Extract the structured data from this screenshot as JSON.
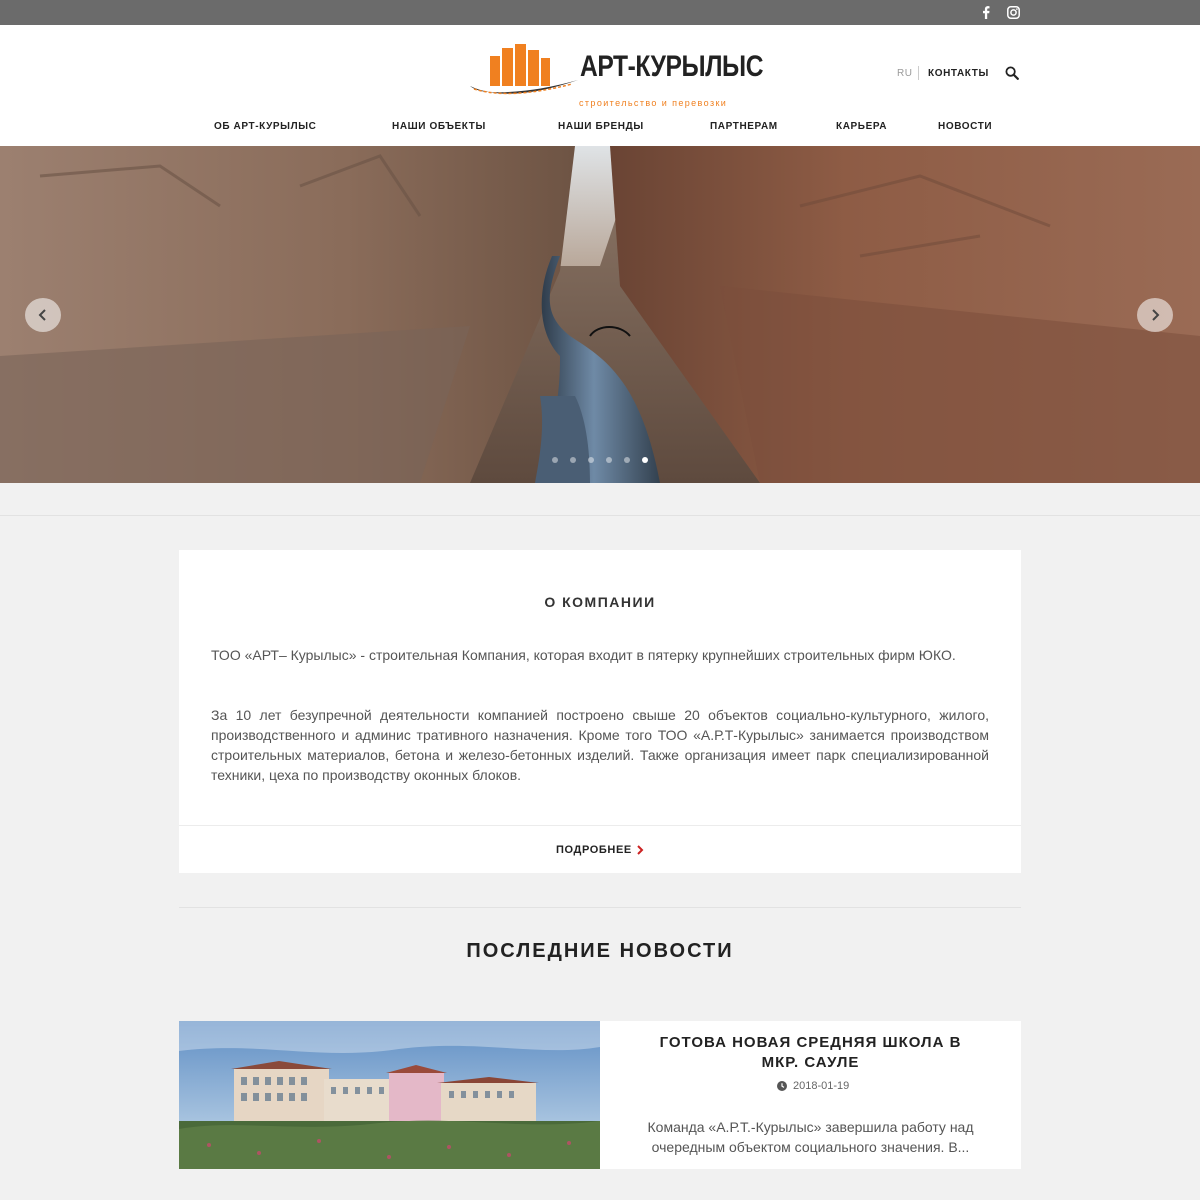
{
  "topbar": {
    "social": [
      {
        "name": "facebook-icon"
      },
      {
        "name": "instagram-icon"
      }
    ]
  },
  "header": {
    "logo": {
      "title": "АРТ-КУРЫЛЫС",
      "subtitle": "строительство и перевозки",
      "colors": {
        "orange": "#f08020",
        "dark": "#222222"
      }
    },
    "lang": "RU",
    "contacts": "КОНТАКТЫ",
    "nav": [
      "ОБ АРТ-КУРЫЛЫС",
      "НАШИ ОБЪЕКТЫ",
      "НАШИ БРЕНДЫ",
      "ПАРТНЕРАМ",
      "КАРЬЕРА",
      "НОВОСТИ"
    ]
  },
  "slider": {
    "slide_count": 6,
    "active_index": 5,
    "prev_icon": "chevron-left-icon",
    "next_icon": "chevron-right-icon"
  },
  "about": {
    "title": "О КОМПАНИИ",
    "paragraph1": "ТОО «АРТ– Курылыс» - строительная Компания, которая входит в пятерку крупнейших строительных фирм ЮКО.",
    "paragraph2": "За 10 лет безупречной деятельности компанией построено свыше 20 объектов социально-культурного, жилого, производственного и админис тративного назначения. Кроме того ТОО «А.Р.Т-Курылыс» занимается производством строительных материалов, бетона и железо-бетонных изделий. Также организация имеет парк специализированной техники, цеха по производству оконных блоков.",
    "more_label": "ПОДРОБНЕЕ",
    "accent_color": "#cc2222"
  },
  "news": {
    "heading": "ПОСЛЕДНИЕ НОВОСТИ",
    "items": [
      {
        "title": "ГОТОВА НОВАЯ СРЕДНЯЯ ШКОЛА В МКР. САУЛЕ",
        "date": "2018-01-19",
        "excerpt": "Команда «А.Р.Т.-Курылыс» завершила работу над очередным объектом социального значения. В..."
      }
    ]
  }
}
